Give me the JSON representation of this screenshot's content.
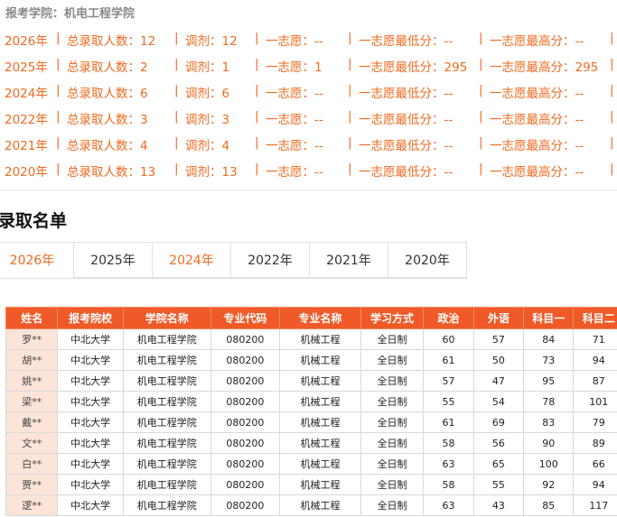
{
  "header": {
    "school_label": "报考学院：机电工程学院"
  },
  "stats": [
    {
      "year": "2026年",
      "total": "总录取人数：12",
      "adjust": "调剂：12",
      "first": "一志愿：--",
      "min": "一志愿最低分：--",
      "max": "一志愿最高分：--"
    },
    {
      "year": "2025年",
      "total": "总录取人数：2",
      "adjust": "调剂：1",
      "first": "一志愿：1",
      "min": "一志愿最低分：295",
      "max": "一志愿最高分：295"
    },
    {
      "year": "2024年",
      "total": "总录取人数：6",
      "adjust": "调剂：6",
      "first": "一志愿：--",
      "min": "一志愿最低分：--",
      "max": "一志愿最高分：--"
    },
    {
      "year": "2022年",
      "total": "总录取人数：3",
      "adjust": "调剂：3",
      "first": "一志愿：--",
      "min": "一志愿最低分：--",
      "max": "一志愿最高分：--"
    },
    {
      "year": "2021年",
      "total": "总录取人数：4",
      "adjust": "调剂：4",
      "first": "一志愿：--",
      "min": "一志愿最低分：--",
      "max": "一志愿最高分：--"
    },
    {
      "year": "2020年",
      "total": "总录取人数：13",
      "adjust": "调剂：13",
      "first": "一志愿：--",
      "min": "一志愿最低分：--",
      "max": "一志愿最高分：--"
    }
  ],
  "separator": "|",
  "section_title": "录取名单",
  "tabs": [
    "2026年",
    "2025年",
    "2024年",
    "2022年",
    "2021年",
    "2020年"
  ],
  "table": {
    "headers": [
      "姓名",
      "报考院校",
      "学院名称",
      "专业代码",
      "专业名称",
      "学习方式",
      "政治",
      "外语",
      "科目一",
      "科目二"
    ],
    "rows": [
      [
        "罗**",
        "中北大学",
        "机电工程学院",
        "080200",
        "机械工程",
        "全日制",
        "60",
        "57",
        "84",
        "71"
      ],
      [
        "胡**",
        "中北大学",
        "机电工程学院",
        "080200",
        "机械工程",
        "全日制",
        "61",
        "50",
        "73",
        "94"
      ],
      [
        "姚**",
        "中北大学",
        "机电工程学院",
        "080200",
        "机械工程",
        "全日制",
        "57",
        "47",
        "95",
        "87"
      ],
      [
        "梁**",
        "中北大学",
        "机电工程学院",
        "080200",
        "机械工程",
        "全日制",
        "55",
        "54",
        "78",
        "101"
      ],
      [
        "戴**",
        "中北大学",
        "机电工程学院",
        "080200",
        "机械工程",
        "全日制",
        "61",
        "69",
        "83",
        "79"
      ],
      [
        "文**",
        "中北大学",
        "机电工程学院",
        "080200",
        "机械工程",
        "全日制",
        "58",
        "56",
        "90",
        "89"
      ],
      [
        "白**",
        "中北大学",
        "机电工程学院",
        "080200",
        "机械工程",
        "全日制",
        "63",
        "65",
        "100",
        "66"
      ],
      [
        "贾**",
        "中北大学",
        "机电工程学院",
        "080200",
        "机械工程",
        "全日制",
        "58",
        "55",
        "92",
        "94"
      ],
      [
        "逻**",
        "中北大学",
        "机电工程学院",
        "080200",
        "机械工程",
        "全日制",
        "63",
        "43",
        "85",
        "117"
      ]
    ]
  },
  "colors": {
    "accent": "#f06a1f",
    "header_bg": "#f05a28",
    "name_bg": "#fde4d8"
  }
}
